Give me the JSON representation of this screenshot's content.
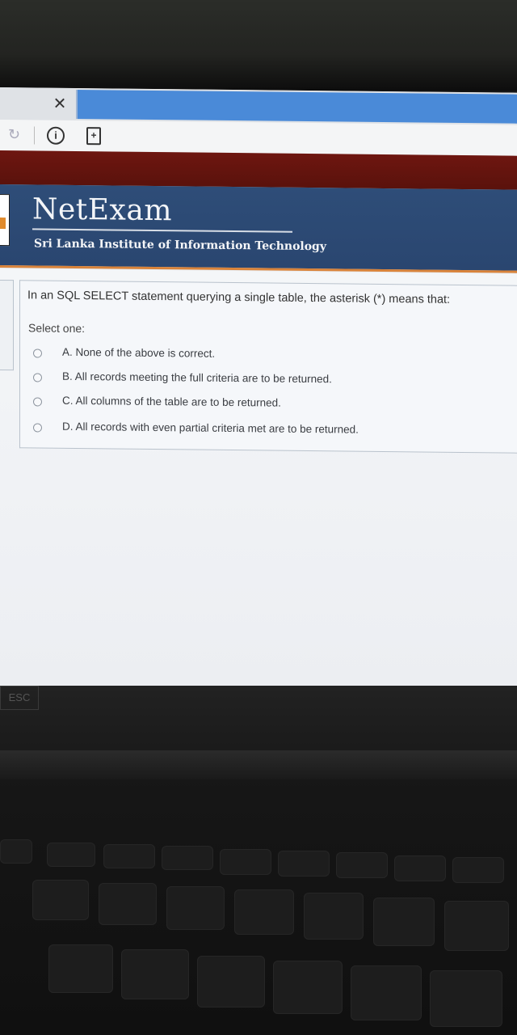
{
  "browser": {
    "close_tab": "✕",
    "icons": [
      "reload-icon",
      "info-icon",
      "page-icon"
    ]
  },
  "header": {
    "brand": "NetExam",
    "institute": "Sri Lanka Institute of Information Technology"
  },
  "quiz": {
    "question": "In an SQL SELECT statement querying a single table, the asterisk (*) means that:",
    "prompt": "Select one:",
    "options": [
      {
        "label": "A. None of the above is correct.",
        "selected": false
      },
      {
        "label": "B. All records meeting the full criteria are to be returned.",
        "selected": false
      },
      {
        "label": "C. All columns of the table are to be returned.",
        "selected": false
      },
      {
        "label": "D. All records with even partial criteria met are to be returned.",
        "selected": false
      }
    ]
  },
  "keyboard": {
    "esc": "ESC"
  },
  "colors": {
    "header_blue": "#2e4d78",
    "accent_orange": "#d9833a",
    "top_red": "#6e1610",
    "tab_blue": "#4a8ad8"
  }
}
